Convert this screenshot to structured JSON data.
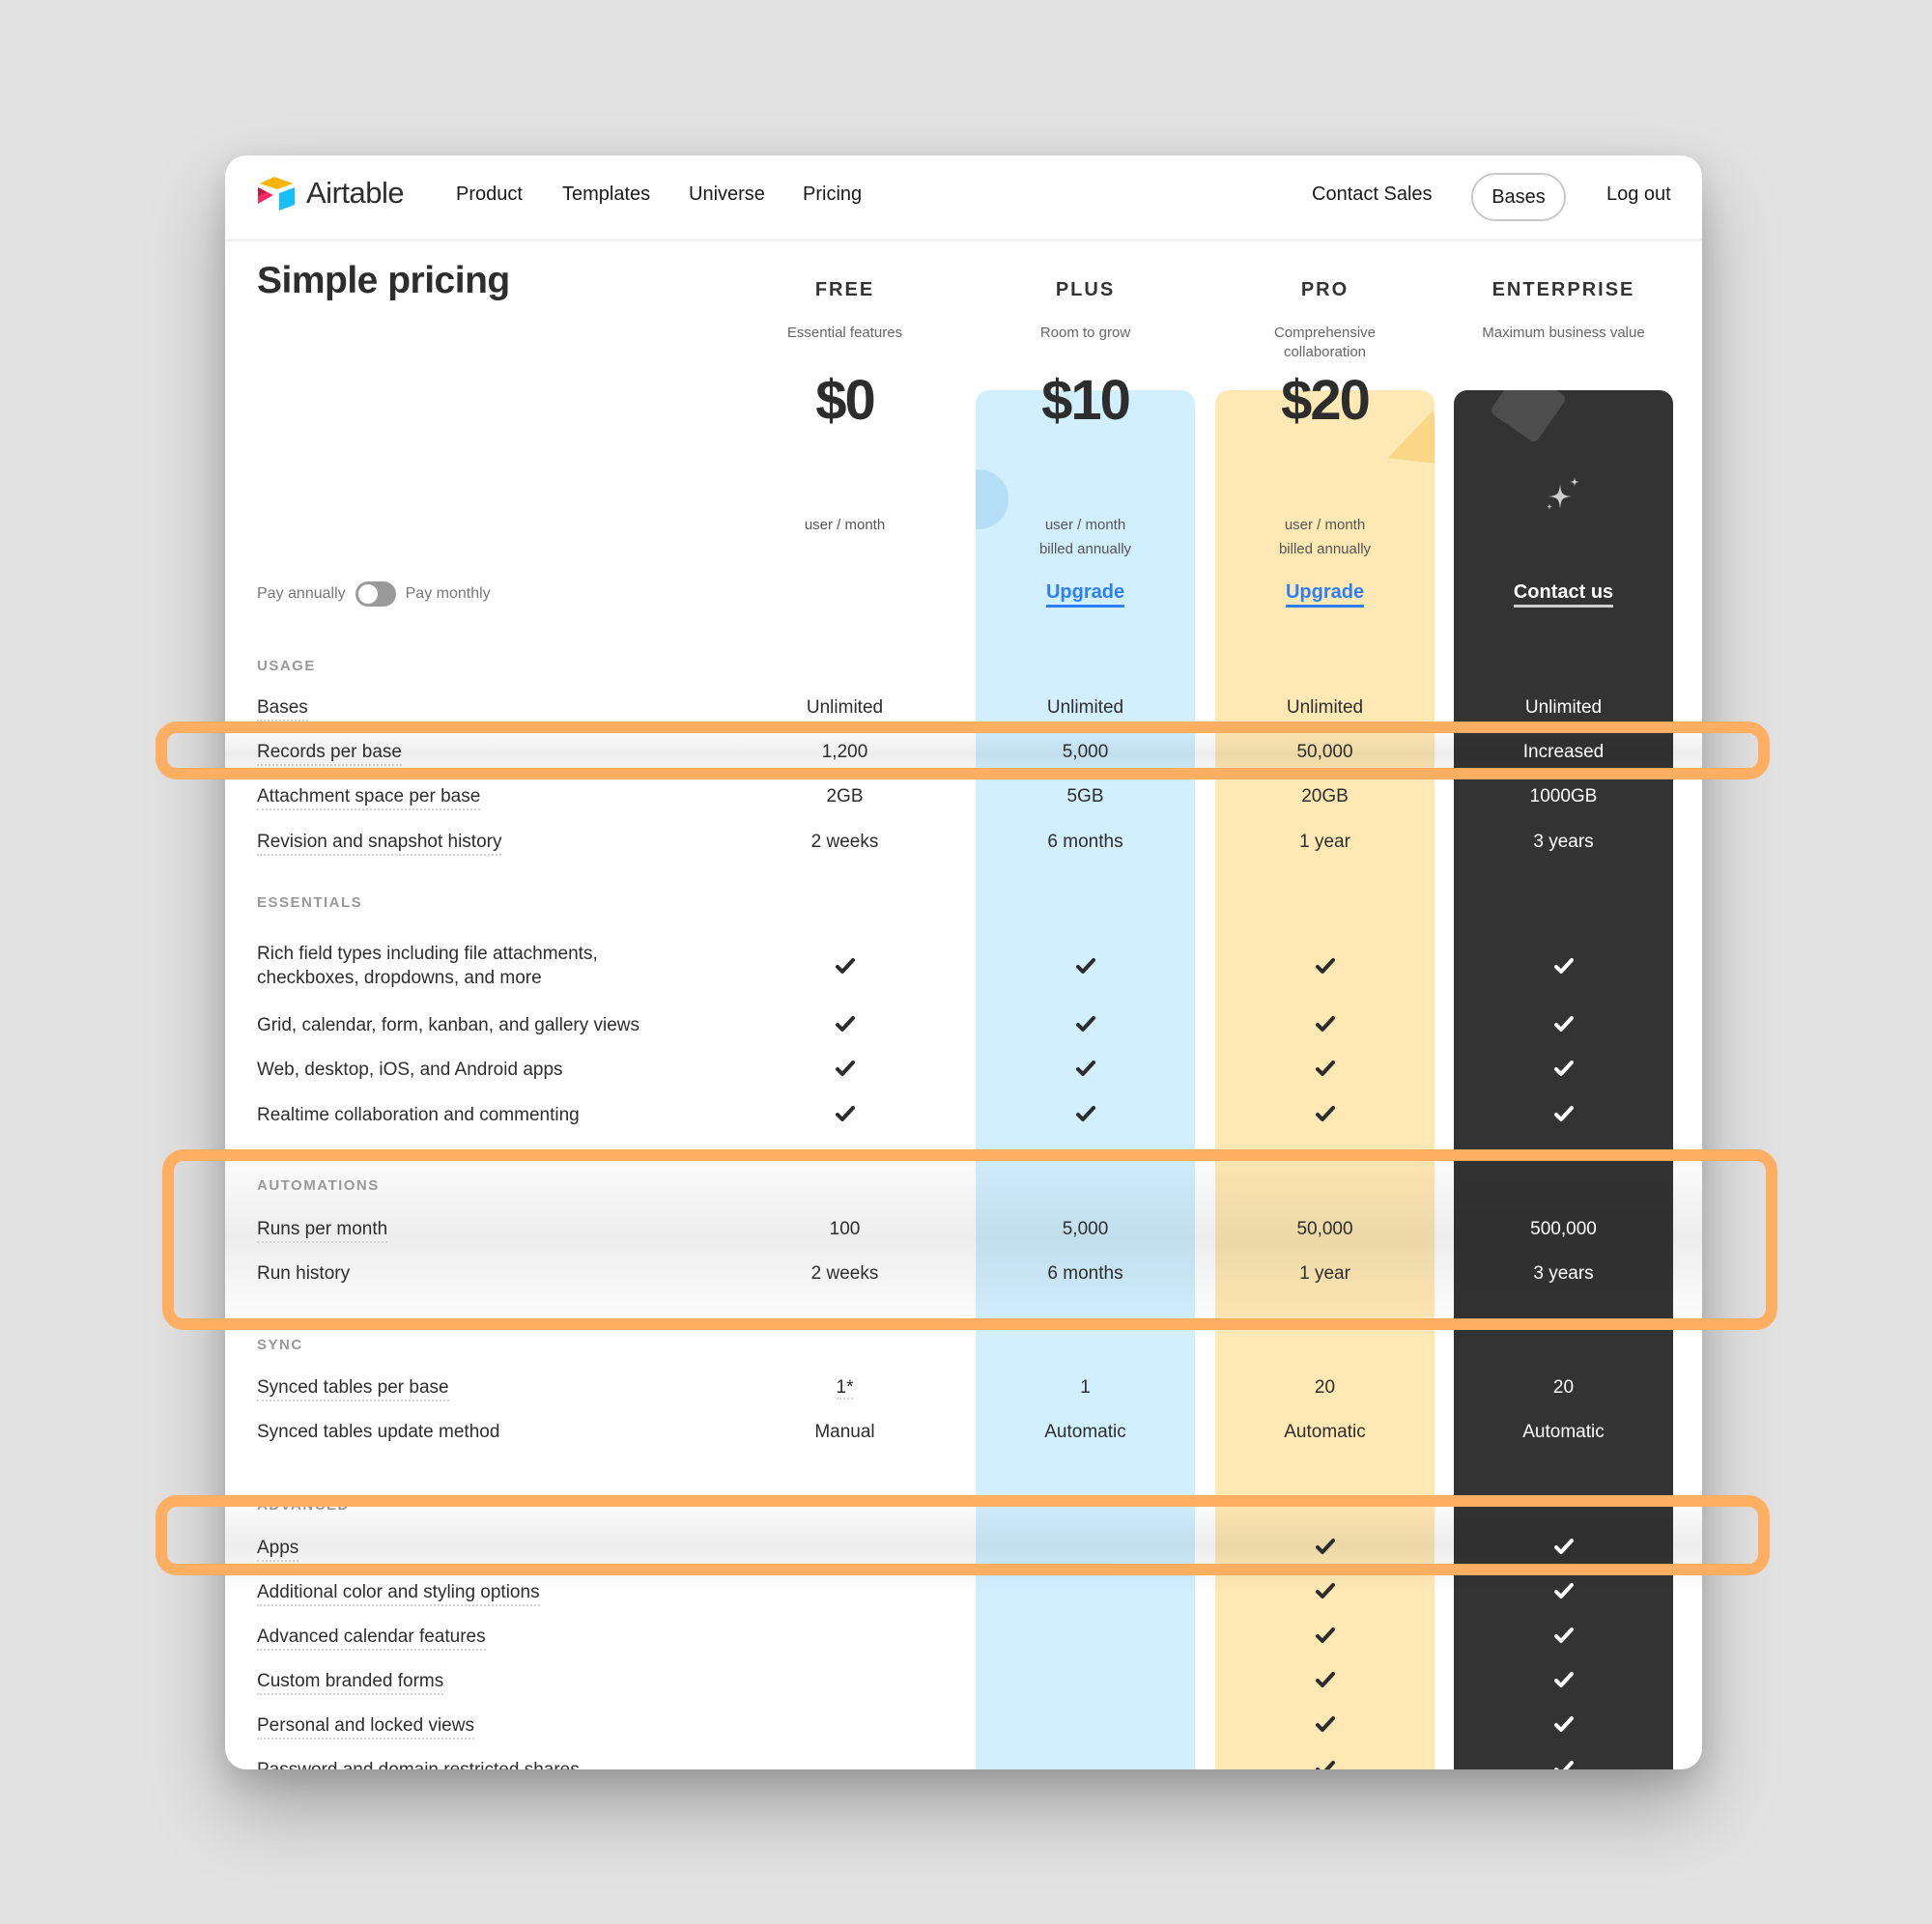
{
  "nav": {
    "brand": "Airtable",
    "links": [
      "Product",
      "Templates",
      "Universe",
      "Pricing"
    ],
    "contact_sales": "Contact Sales",
    "bases": "Bases",
    "logout": "Log out"
  },
  "page_title": "Simple pricing",
  "billing_toggle": {
    "left_label": "Pay annually",
    "right_label": "Pay monthly",
    "monthly_selected": false
  },
  "tiers": [
    {
      "name": "FREE",
      "subtitle": "Essential features",
      "price": "$0",
      "unit": "user / month",
      "billing": "",
      "cta": ""
    },
    {
      "name": "PLUS",
      "subtitle": "Room to grow",
      "price": "$10",
      "unit": "user / month",
      "billing": "billed annually",
      "cta": "Upgrade",
      "color": "#d1efff"
    },
    {
      "name": "PRO",
      "subtitle": "Comprehensive collaboration",
      "subtitle_line1": "Comprehensive",
      "subtitle_line2": "collaboration",
      "price": "$20",
      "unit": "user / month",
      "billing": "billed annually",
      "cta": "Upgrade",
      "color": "#fee8b4"
    },
    {
      "name": "ENTERPRISE",
      "subtitle": "Maximum business value",
      "price": "",
      "unit": "",
      "billing": "",
      "cta": "Contact us",
      "icon": "sparkle-icon",
      "color": "#333333"
    }
  ],
  "sections": {
    "usage": "USAGE",
    "essentials": "ESSENTIALS",
    "automations": "AUTOMATIONS",
    "sync": "SYNC",
    "advanced": "ADVANCED"
  },
  "rows": {
    "bases": {
      "label": "Bases",
      "values": [
        "Unlimited",
        "Unlimited",
        "Unlimited",
        "Unlimited"
      ]
    },
    "records": {
      "label": "Records per base",
      "values": [
        "1,200",
        "5,000",
        "50,000",
        "Increased"
      ]
    },
    "attachment": {
      "label": "Attachment space per base",
      "values": [
        "2GB",
        "5GB",
        "20GB",
        "1000GB"
      ]
    },
    "revision": {
      "label": "Revision and snapshot history",
      "values": [
        "2 weeks",
        "6 months",
        "1 year",
        "3 years"
      ]
    },
    "rich_fields": {
      "label_line1": "Rich field types including file attachments,",
      "label_line2": "checkboxes, dropdowns, and more",
      "values": [
        true,
        true,
        true,
        true
      ]
    },
    "views": {
      "label": "Grid, calendar, form, kanban, and gallery views",
      "values": [
        true,
        true,
        true,
        true
      ]
    },
    "apps_platforms": {
      "label": "Web, desktop, iOS, and Android apps",
      "values": [
        true,
        true,
        true,
        true
      ]
    },
    "realtime": {
      "label": "Realtime collaboration and commenting",
      "values": [
        true,
        true,
        true,
        true
      ]
    },
    "runs": {
      "label": "Runs per month",
      "values": [
        "100",
        "5,000",
        "50,000",
        "500,000"
      ]
    },
    "run_history": {
      "label": "Run history",
      "values": [
        "2 weeks",
        "6 months",
        "1 year",
        "3 years"
      ]
    },
    "synced_tables": {
      "label": "Synced tables per base",
      "values": [
        "1*",
        "1",
        "20",
        "20"
      ]
    },
    "sync_method": {
      "label": "Synced tables update method",
      "values": [
        "Manual",
        "Automatic",
        "Automatic",
        "Automatic"
      ]
    },
    "apps": {
      "label": "Apps",
      "values": [
        false,
        false,
        true,
        true
      ]
    },
    "styling": {
      "label": "Additional color and styling options",
      "values": [
        false,
        false,
        true,
        true
      ]
    },
    "calendar": {
      "label": "Advanced calendar features",
      "values": [
        false,
        false,
        true,
        true
      ]
    },
    "forms": {
      "label": "Custom branded forms",
      "values": [
        false,
        false,
        true,
        true
      ]
    },
    "personal_views": {
      "label": "Personal and locked views",
      "values": [
        false,
        false,
        true,
        true
      ]
    },
    "password_shares": {
      "label": "Password and domain restricted shares",
      "values": [
        false,
        false,
        true,
        true
      ]
    }
  },
  "highlights": [
    "Records per base",
    "Automations section",
    "Apps"
  ],
  "colors": {
    "highlight": "#ffae62",
    "link": "#2d7ff9",
    "plus": "#d1efff",
    "pro": "#fee8b4",
    "enterprise": "#333333"
  }
}
